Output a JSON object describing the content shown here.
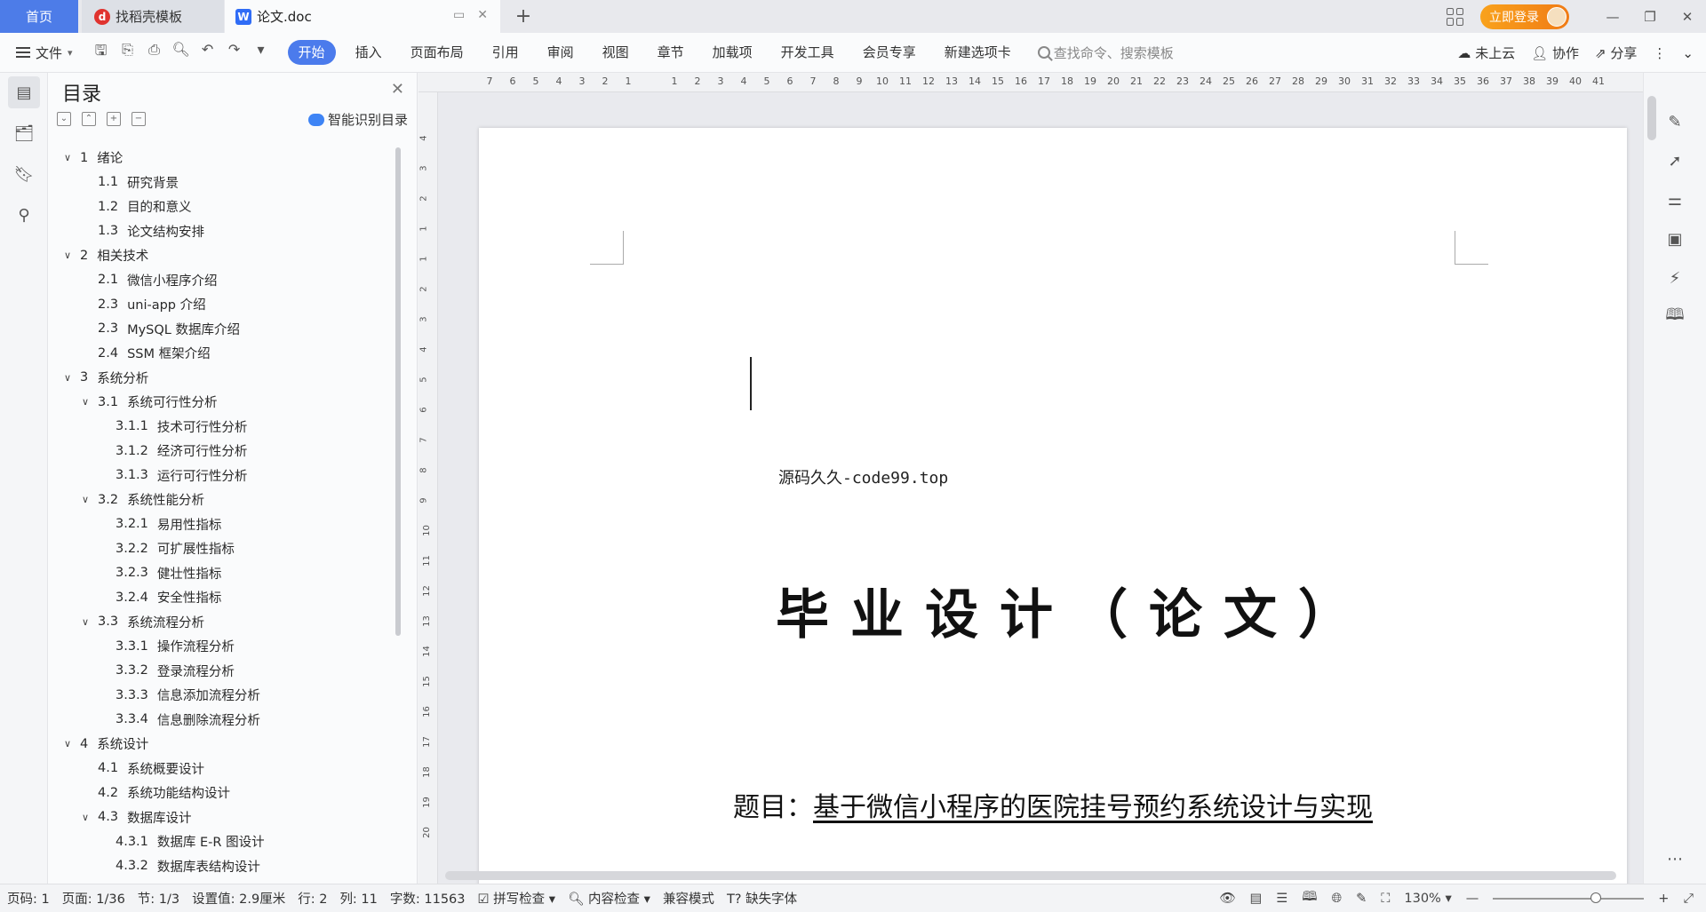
{
  "tabs": {
    "home": "首页",
    "template": "找稻壳模板",
    "doc": "论文.doc"
  },
  "topbar": {
    "login": "立即登录"
  },
  "menubar": {
    "file": "文件",
    "items": [
      "开始",
      "插入",
      "页面布局",
      "引用",
      "审阅",
      "视图",
      "章节",
      "加载项",
      "开发工具",
      "会员专享",
      "新建选项卡"
    ],
    "search_placeholder": "查找命令、搜索模板",
    "cloud": "未上云",
    "collab": "协作",
    "share": "分享"
  },
  "toc": {
    "title": "目录",
    "smart": "智能识别目录",
    "items": [
      {
        "num": "1",
        "text": "绪论",
        "level": 1,
        "chev": true
      },
      {
        "num": "1.1",
        "text": "研究背景",
        "level": 2
      },
      {
        "num": "1.2",
        "text": "目的和意义",
        "level": 2
      },
      {
        "num": "1.3",
        "text": "论文结构安排",
        "level": 2
      },
      {
        "num": "2",
        "text": "相关技术",
        "level": 1,
        "chev": true
      },
      {
        "num": "2.1",
        "text": "微信小程序介绍",
        "level": 2
      },
      {
        "num": "2.3",
        "text": "uni-app 介绍",
        "level": 2
      },
      {
        "num": "2.3",
        "text": "MySQL 数据库介绍",
        "level": 2
      },
      {
        "num": "2.4",
        "text": "SSM 框架介绍",
        "level": 2
      },
      {
        "num": "3",
        "text": "系统分析",
        "level": 1,
        "chev": true
      },
      {
        "num": "3.1",
        "text": "系统可行性分析",
        "level": 2,
        "chev": true
      },
      {
        "num": "3.1.1",
        "text": "技术可行性分析",
        "level": 3
      },
      {
        "num": "3.1.2",
        "text": "经济可行性分析",
        "level": 3
      },
      {
        "num": "3.1.3",
        "text": "运行可行性分析",
        "level": 3
      },
      {
        "num": "3.2",
        "text": "系统性能分析",
        "level": 2,
        "chev": true
      },
      {
        "num": "3.2.1",
        "text": "易用性指标",
        "level": 3
      },
      {
        "num": "3.2.2",
        "text": "可扩展性指标",
        "level": 3
      },
      {
        "num": "3.2.3",
        "text": "健壮性指标",
        "level": 3
      },
      {
        "num": "3.2.4",
        "text": "安全性指标",
        "level": 3
      },
      {
        "num": "3.3",
        "text": "系统流程分析",
        "level": 2,
        "chev": true
      },
      {
        "num": "3.3.1",
        "text": "操作流程分析",
        "level": 3
      },
      {
        "num": "3.3.2",
        "text": "登录流程分析",
        "level": 3
      },
      {
        "num": "3.3.3",
        "text": "信息添加流程分析",
        "level": 3
      },
      {
        "num": "3.3.4",
        "text": "信息删除流程分析",
        "level": 3
      },
      {
        "num": "4",
        "text": "系统设计",
        "level": 1,
        "chev": true
      },
      {
        "num": "4.1",
        "text": "系统概要设计",
        "level": 2
      },
      {
        "num": "4.2",
        "text": "系统功能结构设计",
        "level": 2
      },
      {
        "num": "4.3",
        "text": "数据库设计",
        "level": 2,
        "chev": true
      },
      {
        "num": "4.3.1",
        "text": "数据库 E-R 图设计",
        "level": 3
      },
      {
        "num": "4.3.2",
        "text": "数据库表结构设计",
        "level": 3
      }
    ]
  },
  "ruler": {
    "h": [
      "7",
      "6",
      "5",
      "4",
      "3",
      "2",
      "1",
      "",
      "1",
      "2",
      "3",
      "4",
      "5",
      "6",
      "7",
      "8",
      "9",
      "10",
      "11",
      "12",
      "13",
      "14",
      "15",
      "16",
      "17",
      "18",
      "19",
      "20",
      "21",
      "22",
      "23",
      "24",
      "25",
      "26",
      "27",
      "28",
      "29",
      "30",
      "31",
      "32",
      "33",
      "34",
      "35",
      "36",
      "37",
      "38",
      "39",
      "40",
      "41"
    ],
    "v": [
      "4",
      "3",
      "2",
      "1",
      "1",
      "2",
      "3",
      "4",
      "5",
      "6",
      "7",
      "8",
      "9",
      "10",
      "11",
      "12",
      "13",
      "14",
      "15",
      "16",
      "17",
      "18",
      "19",
      "20"
    ]
  },
  "document": {
    "source_line": "源码久久-code99.top",
    "heading": "毕业设计（论文）",
    "topic_label": "题目：",
    "topic": "基于微信小程序的医院挂号预约系统设计与实现"
  },
  "status": {
    "page_code": "页码: 1",
    "page": "页面: 1/36",
    "section": "节: 1/3",
    "setting": "设置值: 2.9厘米",
    "row": "行: 2",
    "col": "列: 11",
    "words": "字数: 11563",
    "spell": "拼写检查",
    "content_check": "内容检查",
    "compat": "兼容模式",
    "missing_font": "缺失字体",
    "zoom": "130%"
  }
}
